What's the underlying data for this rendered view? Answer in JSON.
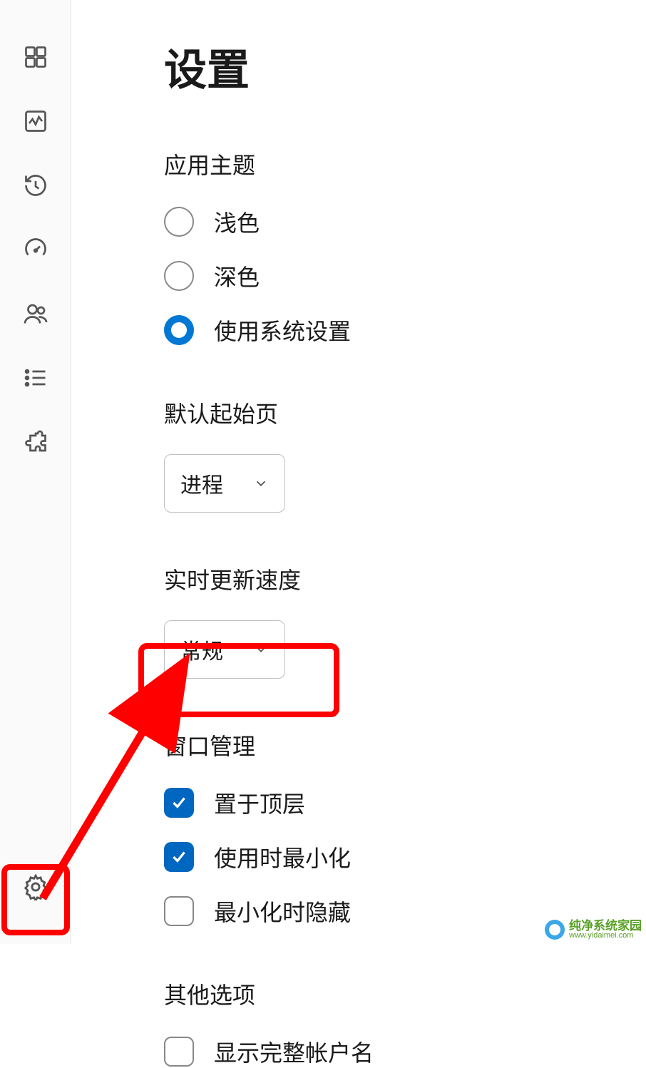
{
  "title": "设置",
  "sections": {
    "theme": {
      "title": "应用主题",
      "options": {
        "light": "浅色",
        "dark": "深色",
        "system": "使用系统设置"
      }
    },
    "startPage": {
      "title": "默认起始页",
      "value": "进程"
    },
    "updateSpeed": {
      "title": "实时更新速度",
      "value": "常规"
    },
    "window": {
      "title": "窗口管理",
      "options": {
        "onTop": "置于顶层",
        "minOnUse": "使用时最小化",
        "hideOnMin": "最小化时隐藏"
      }
    },
    "other": {
      "title": "其他选项",
      "options": {
        "fullAccount": "显示完整帐户名"
      }
    }
  },
  "watermark": {
    "line1": "纯净系统家园",
    "line2": "www.yidaimei.com"
  }
}
